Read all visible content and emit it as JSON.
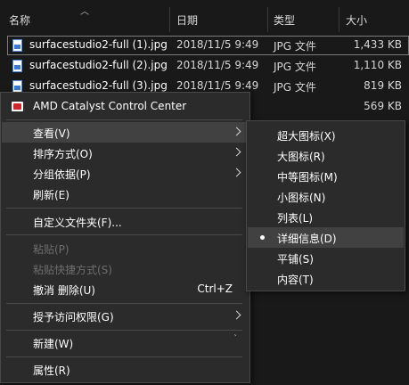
{
  "header": {
    "columns": [
      "名称",
      "日期",
      "类型",
      "大小"
    ]
  },
  "files": [
    {
      "name": "surfacestudio2-full (1).jpg",
      "date": "2018/11/5 9:49",
      "type": "JPG 文件",
      "size": "1,433 KB",
      "selected": true
    },
    {
      "name": "surfacestudio2-full (2).jpg",
      "date": "2018/11/5 9:49",
      "type": "JPG 文件",
      "size": "1,110 KB",
      "selected": false
    },
    {
      "name": "surfacestudio2-full (3).jpg",
      "date": "2018/11/5 9:49",
      "type": "JPG 文件",
      "size": "819 KB",
      "selected": false
    },
    {
      "name": "",
      "date": "",
      "type": "",
      "size": "569 KB",
      "selected": false
    }
  ],
  "context_menu": {
    "amd": "AMD Catalyst Control Center",
    "view": "查看(V)",
    "sort_by": "排序方式(O)",
    "group_by": "分组依据(P)",
    "refresh": "刷新(E)",
    "customize_folder": "自定义文件夹(F)...",
    "paste": "粘贴(P)",
    "paste_shortcut": "粘贴快捷方式(S)",
    "undo_delete": "撤消 删除(U)",
    "undo_shortcut": "Ctrl+Z",
    "grant_access": "授予访问权限(G)",
    "new": "新建(W)",
    "properties": "属性(R)"
  },
  "view_submenu": {
    "items": [
      "超大图标(X)",
      "大图标(R)",
      "中等图标(M)",
      "小图标(N)",
      "列表(L)",
      "详细信息(D)",
      "平铺(S)",
      "内容(T)"
    ],
    "selected_index": 5
  }
}
